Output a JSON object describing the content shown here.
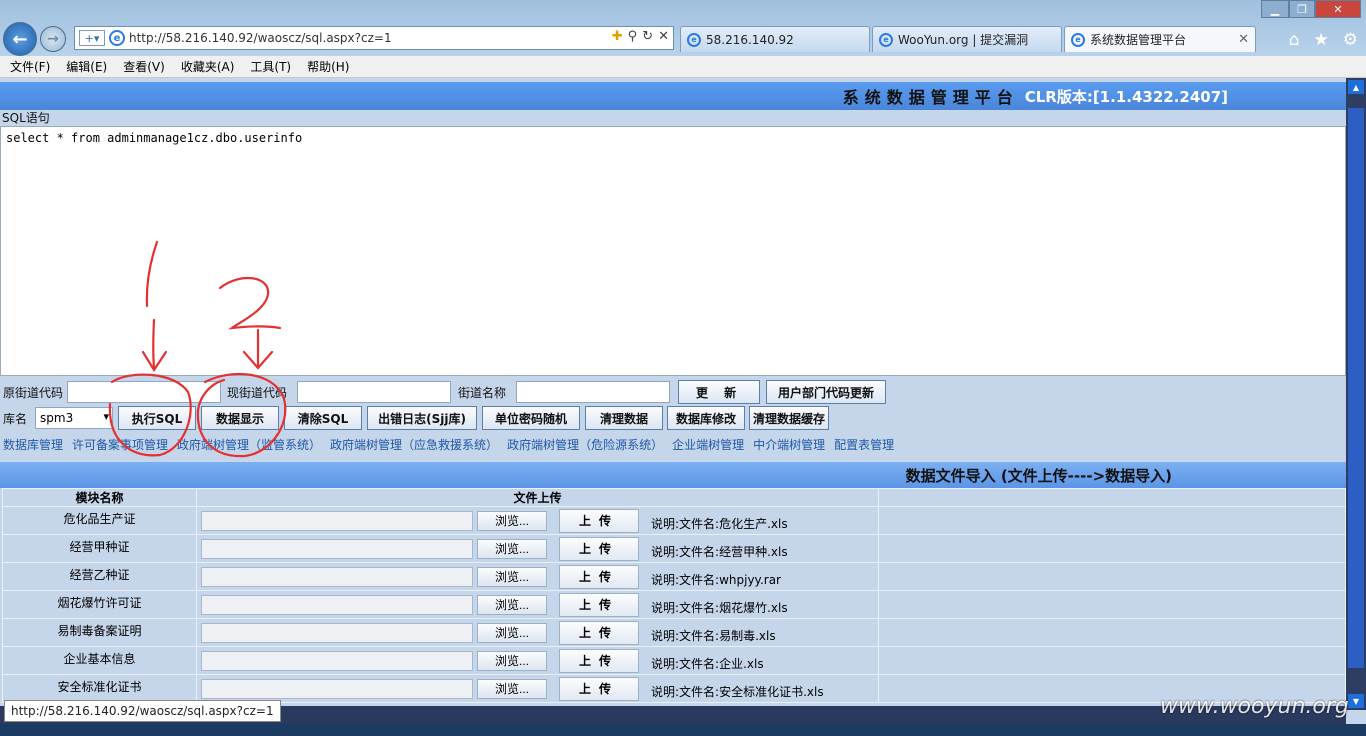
{
  "browser": {
    "address": "http://58.216.140.92/waoscz/sql.aspx?cz=1",
    "tabs": [
      "58.216.140.92",
      "WooYun.org | 提交漏洞",
      "系统数据管理平台"
    ],
    "menu": [
      "文件(F)",
      "编辑(E)",
      "查看(V)",
      "收藏夹(A)",
      "工具(T)",
      "帮助(H)"
    ],
    "status_url": "http://58.216.140.92/waoscz/sql.aspx?cz=1",
    "watermark": "www.wooyun.org"
  },
  "header": {
    "title": "系统数据管理平台",
    "version": "CLR版本:[1.1.4322.2407]"
  },
  "sql": {
    "label": "SQL语句",
    "query": "select * from adminmanage1cz.dbo.userinfo"
  },
  "street_row": {
    "old_code_label": "原街道代码",
    "new_code_label": "现街道代码",
    "name_label": "街道名称",
    "update_btn": "更 新",
    "dept_update_btn": "用户部门代码更新"
  },
  "actions": {
    "db_label": "库名",
    "db_selected": "spm3",
    "exec_sql": "执行SQL",
    "show_data": "数据显示",
    "clear_sql": "清除SQL",
    "error_log": "出错日志(Sjj库)",
    "random_pwd": "单位密码随机",
    "clean_data": "清理数据",
    "db_modify": "数据库修改",
    "clean_cache": "清理数据缓存"
  },
  "links": [
    "数据库管理",
    "许可备案事项管理",
    "政府端树管理（监管系统）",
    "政府端树管理（应急救援系统）",
    "政府端树管理（危险源系统）",
    "企业端树管理",
    "中介端树管理",
    "配置表管理"
  ],
  "import": {
    "title": "数据文件导入 (文件上传---->数据导入)",
    "col_module": "模块名称",
    "col_upload": "文件上传",
    "browse": "浏览...",
    "upload": "上传",
    "rows": [
      {
        "name": "危化品生产证",
        "note": "说明:文件名:危化生产.xls"
      },
      {
        "name": "经营甲种证",
        "note": "说明:文件名:经营甲种.xls"
      },
      {
        "name": "经营乙种证",
        "note": "说明:文件名:whpjyy.rar"
      },
      {
        "name": "烟花爆竹许可证",
        "note": "说明:文件名:烟花爆竹.xls"
      },
      {
        "name": "易制毒备案证明",
        "note": "说明:文件名:易制毒.xls"
      },
      {
        "name": "企业基本信息",
        "note": "说明:文件名:企业.xls"
      },
      {
        "name": "安全标准化证书",
        "note": "说明:文件名:安全标准化证书.xls"
      }
    ]
  },
  "annotations": {
    "mark1": "1.",
    "mark2": "2."
  },
  "colors": {
    "accent": "#4a86da",
    "page_bg": "#c6d6ea",
    "annotation": "#e53030"
  }
}
